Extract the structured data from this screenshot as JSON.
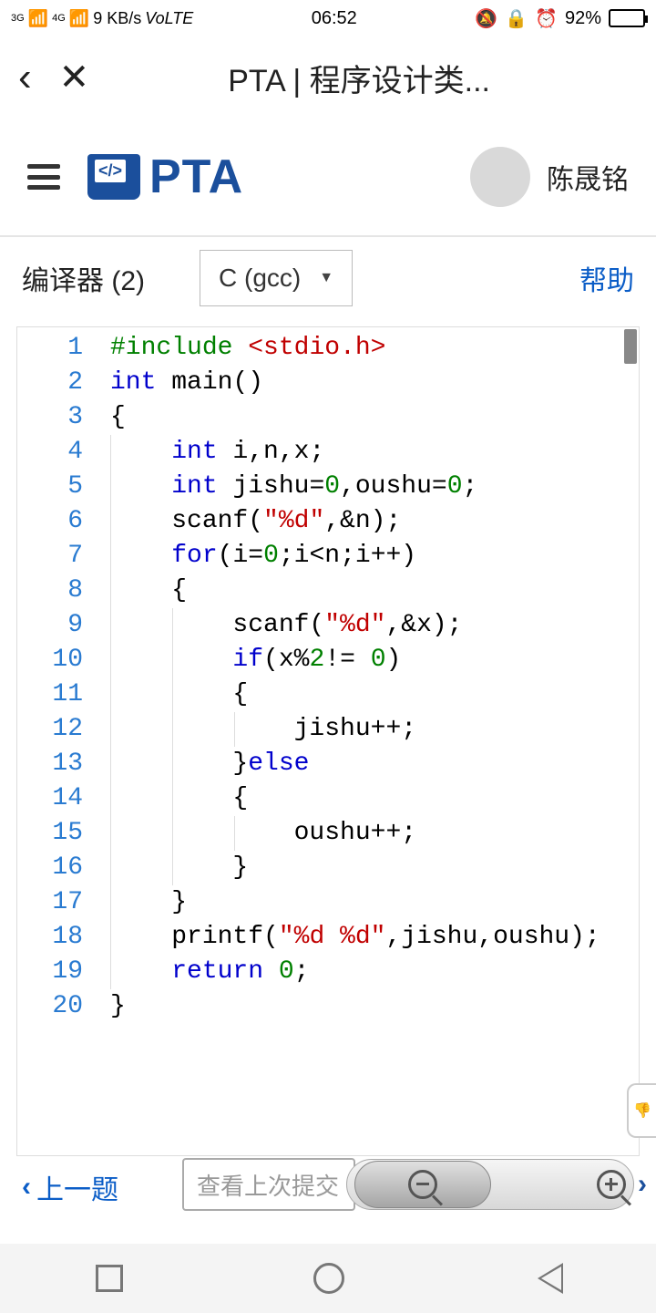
{
  "status": {
    "signal1": "3G",
    "signal2": "4G",
    "speed": "9 KB/s",
    "volte": "VoLTE",
    "time": "06:52",
    "battery_pct": "92%"
  },
  "browser": {
    "title": "PTA | 程序设计类..."
  },
  "header": {
    "logo_text": "PTA",
    "username": "陈晟铭"
  },
  "toolbar": {
    "compiler_label": "编译器 (2)",
    "compiler_selected": "C (gcc)",
    "help": "帮助"
  },
  "editor": {
    "lines": [
      {
        "n": "1",
        "indent": 0,
        "html": "<span class='pp'>#include</span> <span class='hdr'>&lt;stdio.h&gt;</span>"
      },
      {
        "n": "2",
        "indent": 0,
        "html": "<span class='kw'>int</span> main()"
      },
      {
        "n": "3",
        "indent": 0,
        "html": "{"
      },
      {
        "n": "4",
        "indent": 1,
        "html": "<span class='kw'>int</span> i,n,x;"
      },
      {
        "n": "5",
        "indent": 1,
        "html": "<span class='kw'>int</span> jishu=<span class='num'>0</span>,oushu=<span class='num'>0</span>;"
      },
      {
        "n": "6",
        "indent": 1,
        "html": "scanf(<span class='str'>\"%d\"</span>,&amp;n);"
      },
      {
        "n": "7",
        "indent": 1,
        "html": "<span class='kw'>for</span>(i=<span class='num'>0</span>;i&lt;n;i++)"
      },
      {
        "n": "8",
        "indent": 1,
        "html": "{"
      },
      {
        "n": "9",
        "indent": 2,
        "html": "scanf(<span class='str'>\"%d\"</span>,&amp;x);"
      },
      {
        "n": "10",
        "indent": 2,
        "html": "<span class='kw'>if</span>(x%<span class='num'>2</span>!= <span class='num'>0</span>)"
      },
      {
        "n": "11",
        "indent": 2,
        "html": "{"
      },
      {
        "n": "12",
        "indent": 3,
        "html": "jishu++;"
      },
      {
        "n": "13",
        "indent": 2,
        "html": "}<span class='kw'>else</span>"
      },
      {
        "n": "14",
        "indent": 2,
        "html": "{"
      },
      {
        "n": "15",
        "indent": 3,
        "html": "oushu++;"
      },
      {
        "n": "16",
        "indent": 2,
        "html": "}"
      },
      {
        "n": "17",
        "indent": 1,
        "html": "}"
      },
      {
        "n": "18",
        "indent": 1,
        "html": "printf(<span class='str'>\"%d %d\"</span>,jishu,oushu);"
      },
      {
        "n": "19",
        "indent": 1,
        "html": "<span class='kw'>return</span> <span class='num'>0</span>;"
      },
      {
        "n": "20",
        "indent": 0,
        "html": "}"
      }
    ]
  },
  "footer": {
    "prev": "上一题",
    "search_placeholder": "查看上次提交"
  }
}
